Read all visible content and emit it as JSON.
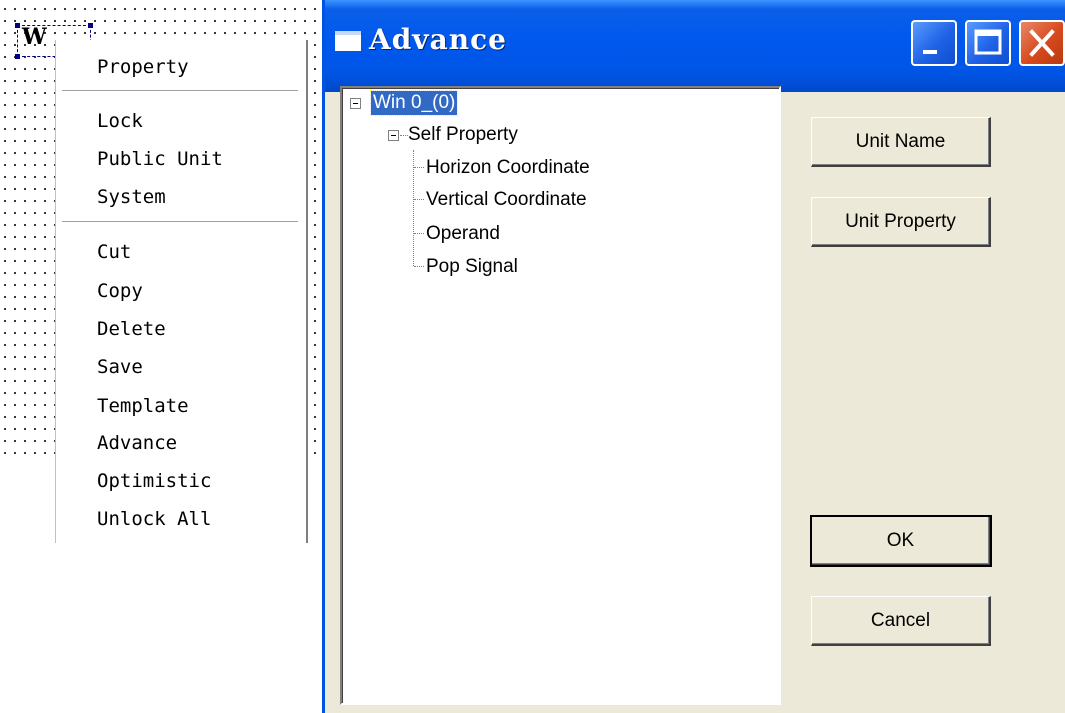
{
  "canvas": {
    "widget_label": "W"
  },
  "context_menu": {
    "items": [
      {
        "label": "Property"
      },
      {
        "label": "Lock"
      },
      {
        "label": "Public Unit"
      },
      {
        "label": "System"
      },
      {
        "label": "Cut"
      },
      {
        "label": "Copy"
      },
      {
        "label": "Delete"
      },
      {
        "label": "Save"
      },
      {
        "label": "Template"
      },
      {
        "label": "Advance"
      },
      {
        "label": "Optimistic"
      },
      {
        "label": "Unlock All"
      }
    ]
  },
  "dialog": {
    "title": "Advance",
    "tree": {
      "root": {
        "label": "Win 0_(0)",
        "selected": true
      },
      "group": {
        "label": "Self Property"
      },
      "leaves": [
        {
          "label": "Horizon Coordinate"
        },
        {
          "label": "Vertical Coordinate"
        },
        {
          "label": "Operand"
        },
        {
          "label": "Pop Signal"
        }
      ]
    },
    "buttons": {
      "unit_name": "Unit Name",
      "unit_property": "Unit Property",
      "ok": "OK",
      "cancel": "Cancel"
    }
  },
  "colors": {
    "titlebar": "#0058ee",
    "dialog_face": "#ece9d8",
    "selection": "#316ac5",
    "close_button": "#d7491c"
  }
}
